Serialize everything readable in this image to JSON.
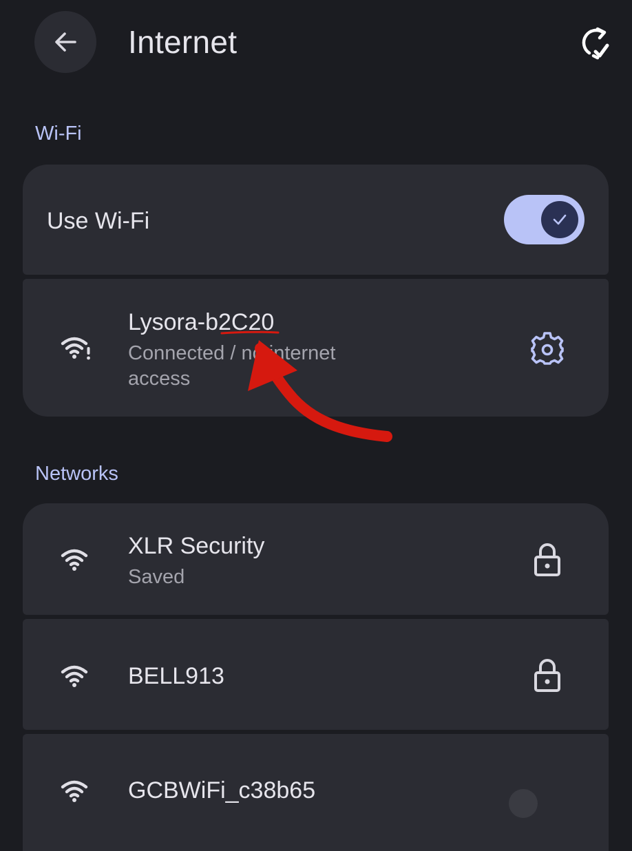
{
  "header": {
    "title": "Internet",
    "back_icon": "arrow-left-icon",
    "refresh_icon": "refresh-icon"
  },
  "wifi_section": {
    "label": "Wi-Fi",
    "use_wifi_label": "Use Wi-Fi",
    "use_wifi_enabled": true,
    "connected_network": {
      "name": "Lysora-b2C20",
      "status_line1": "Connected / no internet",
      "status_line2": "access",
      "icon": "wifi-alert-icon",
      "settings_icon": "gear-icon"
    }
  },
  "networks_section": {
    "label": "Networks",
    "items": [
      {
        "name": "XLR Security",
        "status": "Saved",
        "icon": "wifi-icon",
        "trailing_icon": "lock-icon"
      },
      {
        "name": "BELL913",
        "status": "",
        "icon": "wifi-icon",
        "trailing_icon": "lock-icon"
      },
      {
        "name": "GCBWiFi_c38b65",
        "status": "",
        "icon": "wifi-icon",
        "trailing_icon": ""
      }
    ]
  },
  "colors": {
    "background": "#1b1c21",
    "card": "#2b2c33",
    "accent": "#b9c3f7",
    "annotation_red": "#d6190f"
  }
}
